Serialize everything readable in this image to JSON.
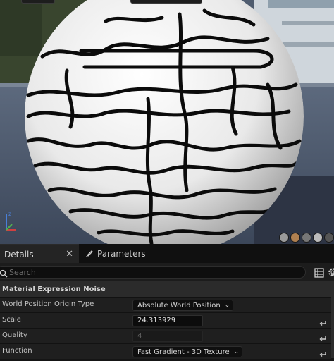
{
  "tabs": {
    "details_label": "Details",
    "close_glyph": "✕",
    "parameters_label": "Parameters"
  },
  "search": {
    "placeholder": "Search"
  },
  "section": {
    "title": "Material Expression Noise"
  },
  "properties": [
    {
      "name": "World Position Origin Type",
      "type": "dropdown",
      "value": "Absolute World Position"
    },
    {
      "name": "Scale",
      "type": "number",
      "value": "24.313929"
    },
    {
      "name": "Quality",
      "type": "number",
      "value": "4",
      "disabled": true
    },
    {
      "name": "Function",
      "type": "dropdown",
      "value": "Fast Gradient - 3D Texture"
    }
  ],
  "icons": {
    "tab_parameters": "paint-brush-icon",
    "search": "search-icon",
    "table_view": "table-icon",
    "settings": "gear-icon",
    "reset": "reset-arrow-icon",
    "axis": "axis-gizmo-icon"
  },
  "colors": {
    "accent_x": "#d04040",
    "accent_y": "#50b050",
    "accent_z": "#4a7fd8",
    "panel_bg": "#1a1a1a",
    "section_bg": "#2b2b2b"
  }
}
